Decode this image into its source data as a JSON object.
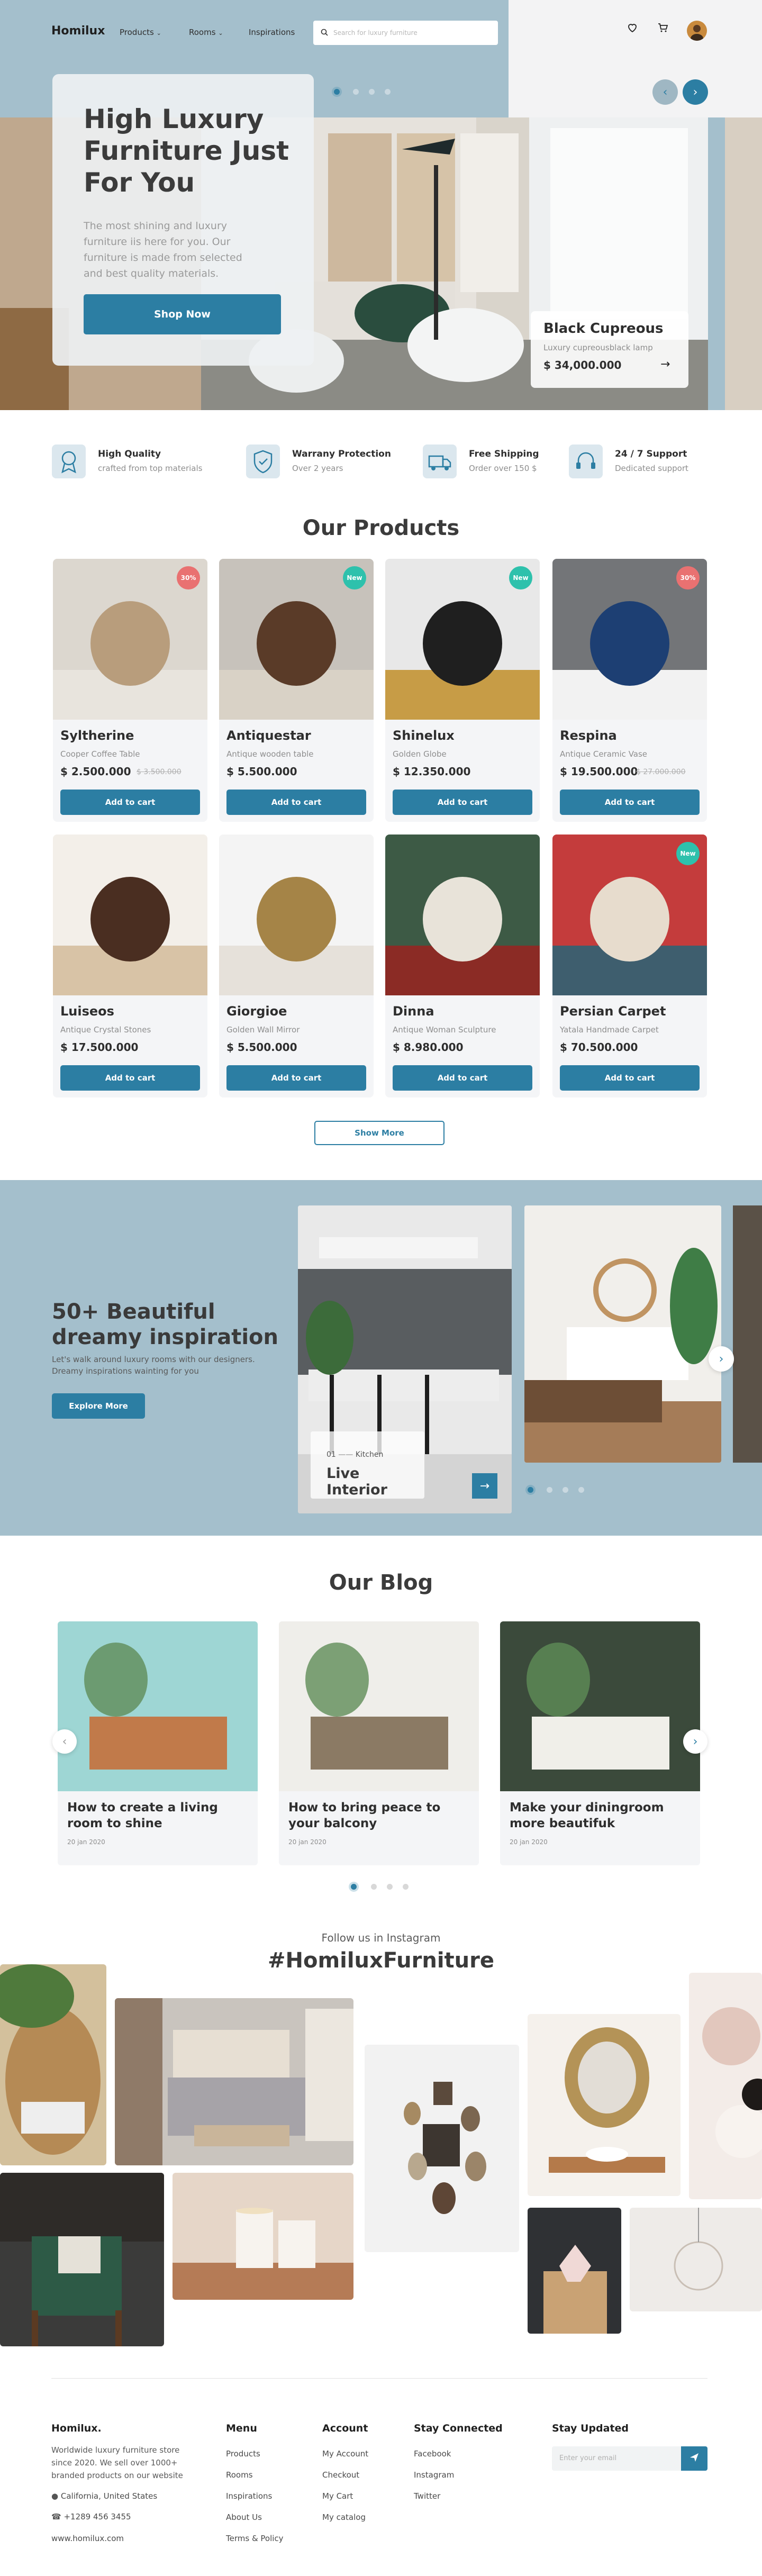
{
  "header": {
    "logo": "Homilux",
    "nav": [
      {
        "label": "Products"
      },
      {
        "label": "Rooms"
      },
      {
        "label": "Inspirations"
      }
    ],
    "search_placeholder": "Search for luxury furniture"
  },
  "hero": {
    "title": "High Luxury Furniture Just For You",
    "subtitle": "The most shining and luxury furniture iis here for you. Our furniture is made from selected and best quality materials.",
    "cta": "Shop Now",
    "spotlight": {
      "name": "Black Cupreous",
      "desc": "Luxury cupreousblack lamp",
      "price": "$ 34,000.000"
    },
    "slides": 4,
    "active_slide": 0
  },
  "features": [
    {
      "title": "High Quality",
      "sub": "crafted from top materials",
      "icon": "award-icon"
    },
    {
      "title": "Warrany Protection",
      "sub": "Over 2 years",
      "icon": "shield-check-icon"
    },
    {
      "title": "Free Shipping",
      "sub": "Order over 150 $",
      "icon": "truck-icon"
    },
    {
      "title": "24 / 7 Support",
      "sub": "Dedicated support",
      "icon": "support-icon"
    }
  ],
  "products": {
    "title": "Our Products",
    "add_label": "Add to cart",
    "more_label": "Show More",
    "items": [
      {
        "name": "Syltherine",
        "desc": "Cooper Coffee Table",
        "price": "$ 2.500.000",
        "old": "$ 3.500.000",
        "badge": "30%",
        "badge_type": "sale"
      },
      {
        "name": "Antiquestar",
        "desc": "Antique wooden table",
        "price": "$ 5.500.000",
        "old": "",
        "badge": "New",
        "badge_type": "new"
      },
      {
        "name": "Shinelux",
        "desc": "Golden Globe",
        "price": "$ 12.350.000",
        "old": "",
        "badge": "New",
        "badge_type": "new"
      },
      {
        "name": "Respina",
        "desc": "Antique Ceramic Vase",
        "price": "$ 19.500.000",
        "old": "$ 27.000.000",
        "badge": "30%",
        "badge_type": "sale"
      },
      {
        "name": "Luiseos",
        "desc": "Antique Crystal Stones",
        "price": "$ 17.500.000",
        "old": "",
        "badge": "",
        "badge_type": ""
      },
      {
        "name": "Giorgioe",
        "desc": "Golden Wall Mirror",
        "price": "$ 5.500.000",
        "old": "",
        "badge": "",
        "badge_type": ""
      },
      {
        "name": "Dinna",
        "desc": "Antique Woman Sculpture",
        "price": "$ 8.980.000",
        "old": "",
        "badge": "",
        "badge_type": ""
      },
      {
        "name": "Persian Carpet",
        "desc": "Yatala Handmade Carpet",
        "price": "$ 70.500.000",
        "old": "",
        "badge": "New",
        "badge_type": "new"
      }
    ]
  },
  "inspiration": {
    "title": "50+ Beautiful dreamy inspiration",
    "sub": "Let's walk around luxury rooms with our designers. Dreamy inspirations wainting for you",
    "cta": "Explore More",
    "card": {
      "index": "01",
      "room": "Kitchen",
      "name": "Live Interior"
    }
  },
  "blog": {
    "title": "Our Blog",
    "posts": [
      {
        "title": "How to create a living room to shine",
        "date": "20 jan 2020"
      },
      {
        "title": "How to bring peace to your balcony",
        "date": "20 jan 2020"
      },
      {
        "title": "Make your diningroom more beautifuk",
        "date": "20 jan 2020"
      }
    ]
  },
  "instagram": {
    "kicker": "Follow us in Instagram",
    "tag": "#HomiluxFurniture"
  },
  "footer": {
    "brand": "Homilux.",
    "about": "Worldwide luxury furniture store since 2020. We sell over 1000+ branded products on our website",
    "address": "California, United States",
    "phone": "+1289 456 3455",
    "site": "www.homilux.com",
    "menu": {
      "title": "Menu",
      "links": [
        "Products",
        "Rooms",
        "Inspirations",
        "About Us",
        "Terms & Policy"
      ]
    },
    "account": {
      "title": "Account",
      "links": [
        "My Account",
        "Checkout",
        "My Cart",
        "My catalog"
      ]
    },
    "social": {
      "title": "Stay Connected",
      "links": [
        "Facebook",
        "Instagram",
        "Twitter"
      ]
    },
    "newsletter": {
      "title": "Stay Updated",
      "placeholder": "Enter your email"
    }
  },
  "colors": {
    "accent": "#2c7ea3",
    "hero_bg": "#a4bfcc",
    "sale": "#e97171",
    "new": "#2ec1ac"
  }
}
